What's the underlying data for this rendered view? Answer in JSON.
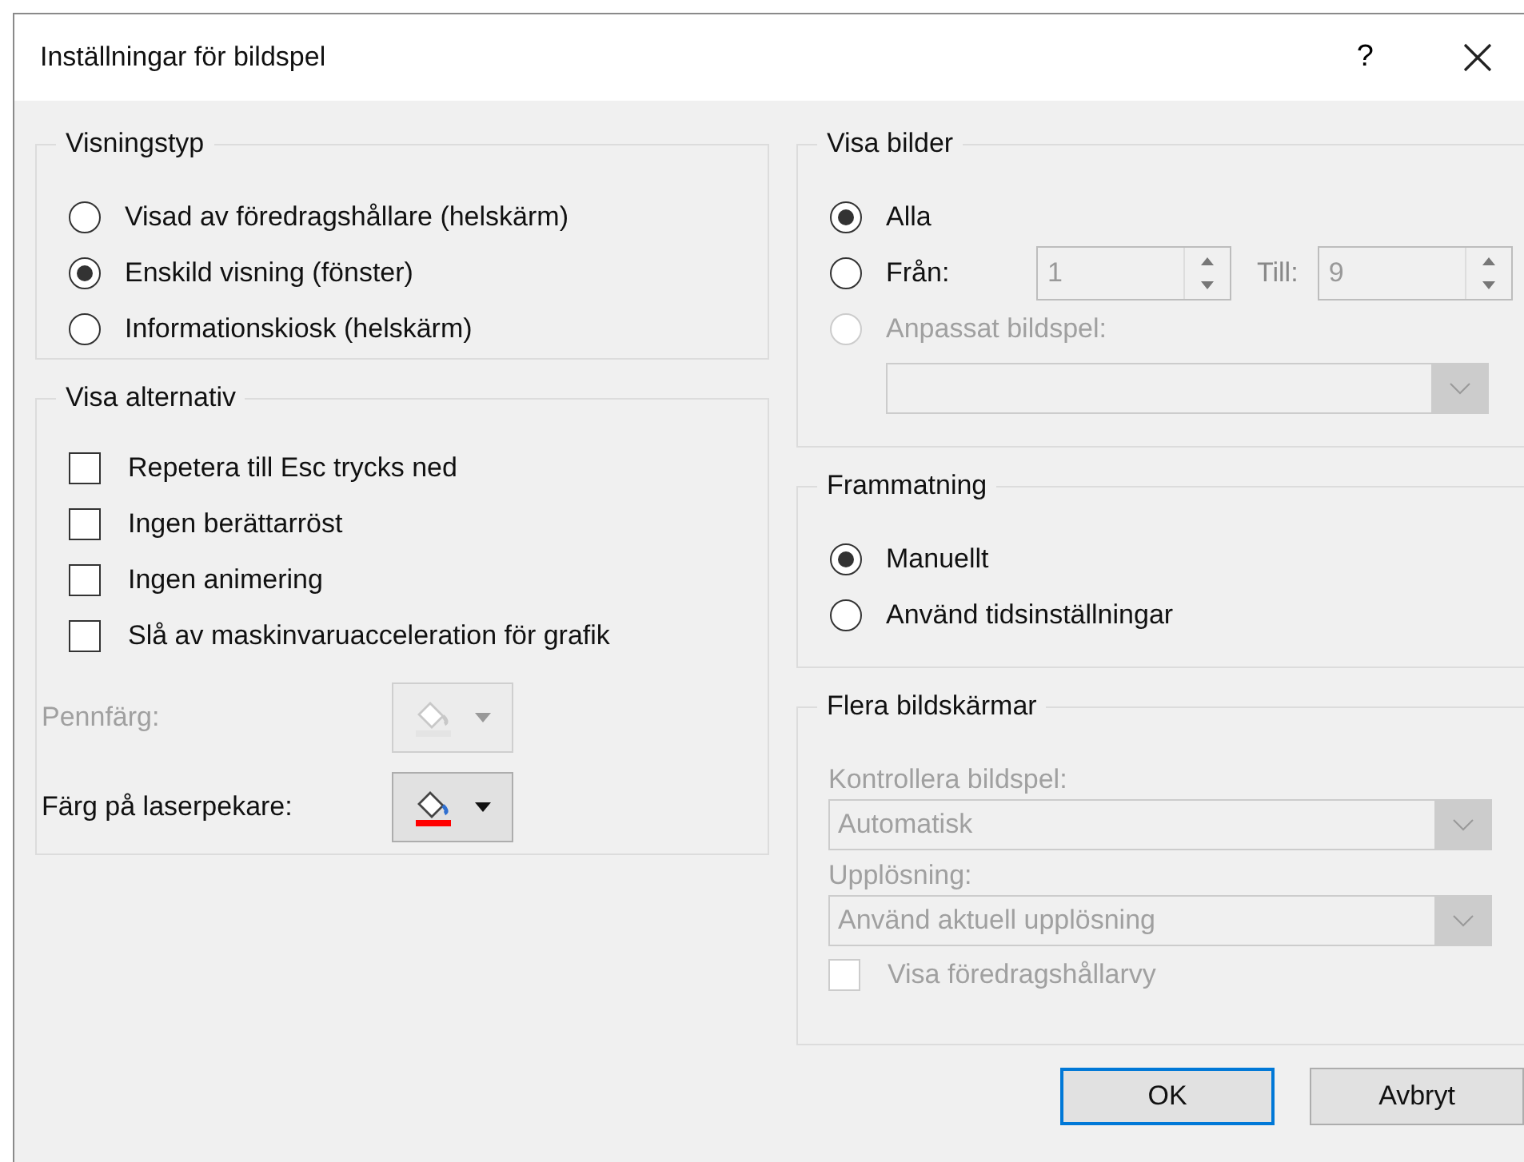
{
  "window": {
    "title": "Inställningar för bildspel",
    "help": "?"
  },
  "show_type": {
    "title": "Visningstyp",
    "options": [
      {
        "label": "Visad av föredragshållare (helskärm)",
        "selected": false
      },
      {
        "label": "Enskild visning (fönster)",
        "selected": true
      },
      {
        "label": "Informationskiosk (helskärm)",
        "selected": false
      }
    ]
  },
  "show_options": {
    "title": "Visa alternativ",
    "checkboxes": [
      {
        "label": "Repetera till Esc trycks ned",
        "checked": false
      },
      {
        "label": "Ingen berättarröst",
        "checked": false
      },
      {
        "label": "Ingen animering",
        "checked": false
      },
      {
        "label": "Slå av maskinvaruacceleration för grafik",
        "checked": false
      }
    ],
    "color_pickers": [
      {
        "label": "Pennfärg:",
        "disabled": true,
        "color": "#e4e4e4"
      },
      {
        "label": "Färg på laserpekare:",
        "disabled": false,
        "color": "#ff0000"
      }
    ]
  },
  "slides": {
    "title": "Visa bilder",
    "options": [
      {
        "kind": "all",
        "label": "Alla",
        "selected": true,
        "disabled": false
      },
      {
        "kind": "range",
        "label": "Från:",
        "selected": false,
        "disabled": false,
        "from": "1",
        "to_label": "Till:",
        "to": "9",
        "fields_disabled": true
      },
      {
        "kind": "custom",
        "label": "Anpassat bildspel:",
        "selected": false,
        "disabled": true
      }
    ]
  },
  "advance": {
    "title": "Frammatning",
    "options": [
      {
        "label": "Manuellt",
        "selected": true
      },
      {
        "label": "Använd tidsinställningar",
        "selected": false
      }
    ]
  },
  "monitors": {
    "title": "Flera bildskärmar",
    "disabled": true,
    "show_on_label": "Kontrollera bildspel:",
    "show_on": "Automatisk",
    "resolution_label": "Upplösning:",
    "resolution": "Använd aktuell upplösning",
    "presenter_view": {
      "label": "Visa föredragshållarvy",
      "checked": false
    }
  },
  "buttons": [
    {
      "label": "OK",
      "default": true
    },
    {
      "label": "Avbryt",
      "default": false
    }
  ]
}
